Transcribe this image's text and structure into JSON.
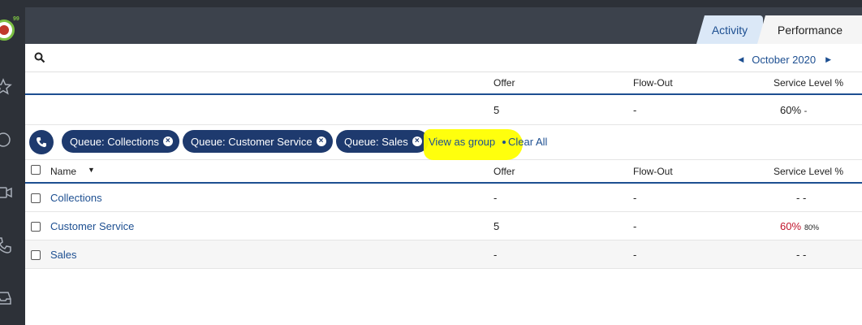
{
  "sidebar": {
    "logo_badge": "99",
    "icons": [
      "star-icon",
      "chat-icon",
      "video-icon",
      "phone-icon",
      "inbox-icon"
    ]
  },
  "tabs": [
    {
      "label": "Activity",
      "active": false
    },
    {
      "label": "Performance",
      "active": true
    }
  ],
  "period": {
    "label": "October 2020"
  },
  "columns": {
    "offer": "Offer",
    "flow_out": "Flow-Out",
    "service_level": "Service Level %"
  },
  "summary": {
    "offer": "5",
    "flow_out": "-",
    "service_level": "60%",
    "service_level_target": "-"
  },
  "filters": {
    "chips": [
      "Queue: Collections",
      "Queue: Customer Service",
      "Queue: Sales"
    ],
    "view_as_group": "View as group",
    "clear_all": "Clear All"
  },
  "table": {
    "name_header": "Name",
    "rows": [
      {
        "name": "Collections",
        "offer": "-",
        "flow_out": "-",
        "service_level": "- -"
      },
      {
        "name": "Customer Service",
        "offer": "5",
        "flow_out": "-",
        "service_level": "60%",
        "service_level_target": "80%"
      },
      {
        "name": "Sales",
        "offer": "-",
        "flow_out": "-",
        "service_level": "- -"
      }
    ]
  },
  "colors": {
    "accent": "#1d4f91",
    "chip": "#1e3a6e",
    "alert": "#c0142b",
    "highlight": "#ffff00"
  }
}
